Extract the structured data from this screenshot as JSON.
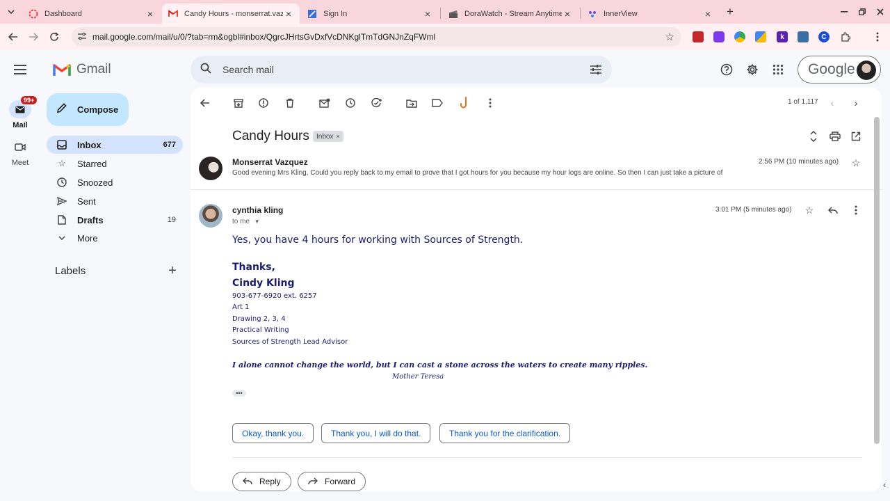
{
  "browser": {
    "tabs": [
      {
        "title": "Dashboard",
        "active": false
      },
      {
        "title": "Candy Hours - monserrat.vazq",
        "active": true
      },
      {
        "title": "Sign In",
        "active": false
      },
      {
        "title": "DoraWatch - Stream Anytime, A",
        "active": false
      },
      {
        "title": "InnerView",
        "active": false
      }
    ],
    "new_tab": "+",
    "url": "mail.google.com/mail/u/0/?tab=rm&ogbl#inbox/QgrcJHrtsGvDxfVcDNKglTmTdGNJnZqFWml"
  },
  "rail": {
    "mail_label": "Mail",
    "mail_badge": "99+",
    "meet_label": "Meet"
  },
  "header": {
    "logo_text": "Gmail",
    "search_placeholder": "Search mail",
    "account_brand": "Google"
  },
  "sidebar": {
    "compose": "Compose",
    "items": [
      {
        "label": "Inbox",
        "count": "677",
        "icon": "inbox-icon",
        "selected": true
      },
      {
        "label": "Starred",
        "count": "",
        "icon": "star-icon"
      },
      {
        "label": "Snoozed",
        "count": "",
        "icon": "clock-icon"
      },
      {
        "label": "Sent",
        "count": "",
        "icon": "send-icon"
      },
      {
        "label": "Drafts",
        "count": "19",
        "icon": "draft-icon"
      },
      {
        "label": "More",
        "count": "",
        "icon": "chevron-down-icon"
      }
    ],
    "labels_title": "Labels"
  },
  "toolbar": {
    "pager": "1 of 1,117"
  },
  "thread": {
    "subject": "Candy Hours",
    "chip": "Inbox",
    "chip_close": "×",
    "messages": [
      {
        "sender": "Monserrat Vazquez",
        "time": "2:56 PM (10 minutes ago)",
        "snippet": "Good evening Mrs Kling, Could you reply back to my email to prove that I got hours for you because my hour logs are online. So then I can just take a picture of"
      },
      {
        "sender": "cynthia kling",
        "time": "3:01 PM (5 minutes ago)",
        "to": "to me",
        "body": "Yes, you have 4 hours for working with Sources of Strength.",
        "signature": {
          "thanks": "Thanks,",
          "name": "Cindy Kling",
          "lines": [
            "903-677-6920 ext. 6257",
            "Art 1",
            "Drawing 2, 3, 4",
            "Practical Writing",
            "Sources of Strength Lead Advisor"
          ],
          "quote": "I alone cannot change the world, but I can cast a stone across the waters to create many ripples.",
          "quote_author": "Mother Teresa"
        },
        "ellipsis": "•••"
      }
    ],
    "smart_replies": [
      "Okay, thank you.",
      "Thank you, I will do that.",
      "Thank you for the clarification."
    ],
    "reply_label": "Reply",
    "forward_label": "Forward"
  },
  "colors": {
    "tabstrip": "#f9d5dc",
    "compose": "#c2e7ff",
    "selected_nav": "#d3e3fd",
    "link_blue": "#0b57d0",
    "signature_navy": "#1c1c70"
  }
}
